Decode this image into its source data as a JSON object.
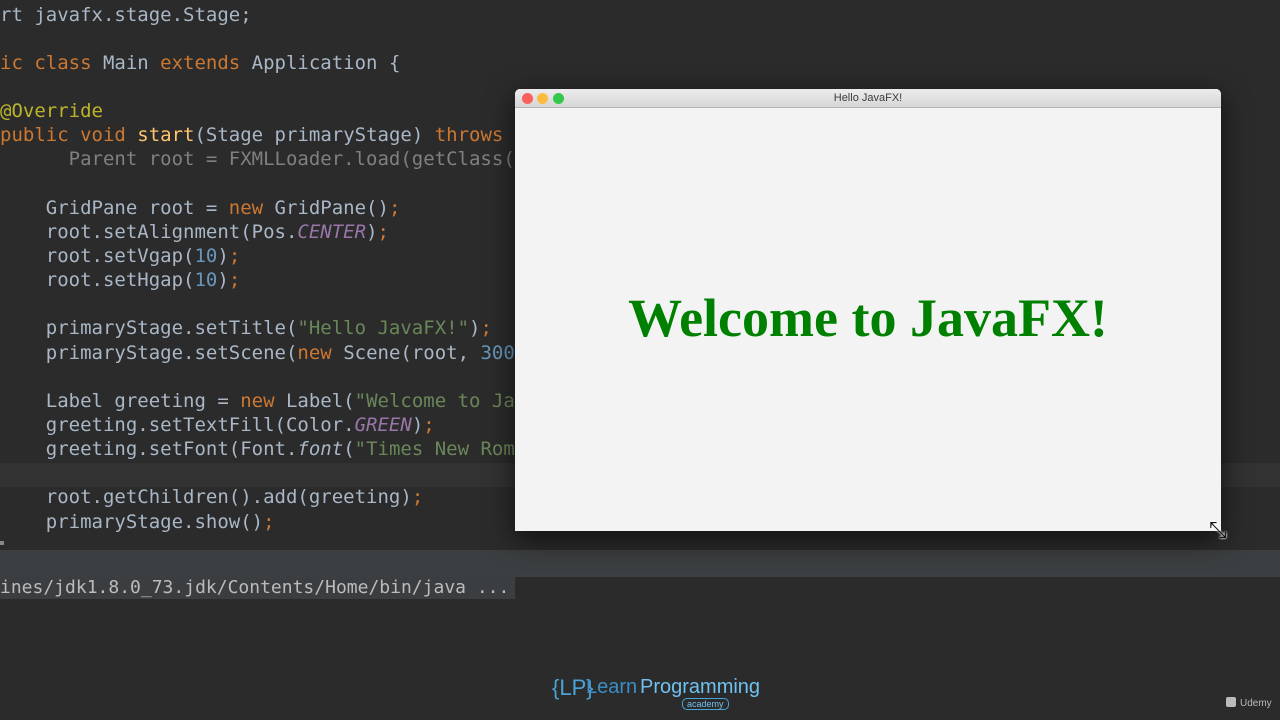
{
  "editor": {
    "lines": [
      {
        "segs": [
          {
            "t": "rt javafx.stage.Stage;",
            "c": ""
          }
        ]
      },
      {
        "segs": [
          {
            "t": "ic class ",
            "c": "kw"
          },
          {
            "t": "Main ",
            "c": ""
          },
          {
            "t": "extends ",
            "c": "kw"
          },
          {
            "t": "Application {",
            "c": ""
          }
        ]
      },
      {
        "segs": [
          {
            "t": "@Override",
            "c": "ann"
          }
        ]
      },
      {
        "segs": [
          {
            "t": "public void ",
            "c": "kw"
          },
          {
            "t": "start",
            "c": "meth"
          },
          {
            "t": "(Stage primaryStage) ",
            "c": ""
          },
          {
            "t": "throws",
            "c": "kw"
          }
        ]
      },
      {
        "segs": [
          {
            "t": "      Parent root = FXMLLoader.load(getClass(",
            "c": "dim"
          }
        ]
      },
      {
        "segs": [
          {
            "t": "    GridPane root = ",
            "c": ""
          },
          {
            "t": "new ",
            "c": "kw"
          },
          {
            "t": "GridPane()",
            "c": ""
          },
          {
            "t": ";",
            "c": "kw"
          }
        ]
      },
      {
        "segs": [
          {
            "t": "    root.setAlignment(Pos.",
            "c": ""
          },
          {
            "t": "CENTER",
            "c": "const"
          },
          {
            "t": ")",
            "c": ""
          },
          {
            "t": ";",
            "c": "kw"
          }
        ]
      },
      {
        "segs": [
          {
            "t": "    root.setVgap(",
            "c": ""
          },
          {
            "t": "10",
            "c": "num"
          },
          {
            "t": ")",
            "c": ""
          },
          {
            "t": ";",
            "c": "kw"
          }
        ]
      },
      {
        "segs": [
          {
            "t": "    root.setHgap(",
            "c": ""
          },
          {
            "t": "10",
            "c": "num"
          },
          {
            "t": ")",
            "c": ""
          },
          {
            "t": ";",
            "c": "kw"
          }
        ]
      },
      {
        "segs": [
          {
            "t": "    primaryStage.setTitle(",
            "c": ""
          },
          {
            "t": "\"Hello JavaFX!\"",
            "c": "str"
          },
          {
            "t": ")",
            "c": ""
          },
          {
            "t": ";",
            "c": "kw"
          }
        ]
      },
      {
        "segs": [
          {
            "t": "    primaryStage.setScene(",
            "c": ""
          },
          {
            "t": "new ",
            "c": "kw"
          },
          {
            "t": "Scene(root, ",
            "c": ""
          },
          {
            "t": "300",
            "c": "num"
          }
        ]
      },
      {
        "segs": [
          {
            "t": "    Label greeting = ",
            "c": ""
          },
          {
            "t": "new ",
            "c": "kw"
          },
          {
            "t": "Label(",
            "c": ""
          },
          {
            "t": "\"Welcome to Ja",
            "c": "str"
          }
        ]
      },
      {
        "segs": [
          {
            "t": "    greeting.setTextFill(Color.",
            "c": ""
          },
          {
            "t": "GREEN",
            "c": "const"
          },
          {
            "t": ")",
            "c": ""
          },
          {
            "t": ";",
            "c": "kw"
          }
        ]
      },
      {
        "segs": [
          {
            "t": "    greeting.setFont(Font.",
            "c": ""
          },
          {
            "t": "font",
            "c": "ital"
          },
          {
            "t": "(",
            "c": ""
          },
          {
            "t": "\"Times New Rom",
            "c": "str"
          }
        ]
      },
      {
        "segs": [
          {
            "t": "    root.getChildren().add(greeting)",
            "c": ""
          },
          {
            "t": ";",
            "c": "kw"
          }
        ]
      },
      {
        "segs": [
          {
            "t": "    primaryStage.show()",
            "c": ""
          },
          {
            "t": ";",
            "c": "kw"
          }
        ]
      }
    ]
  },
  "console": {
    "command": "ines/jdk1.8.0_73.jdk/Contents/Home/bin/java ..."
  },
  "fx_window": {
    "title": "Hello JavaFX!",
    "greeting": "Welcome to JavaFX!",
    "greeting_color": "#008000"
  },
  "cursor": {
    "glyph": "⤡",
    "icon": "resize-diagonal-icon"
  },
  "watermark": {
    "logo_mark": "{LP}",
    "logo_learn": "Learn",
    "logo_programming": "Programming",
    "logo_academy": "academy",
    "udemy": "Udemy"
  }
}
